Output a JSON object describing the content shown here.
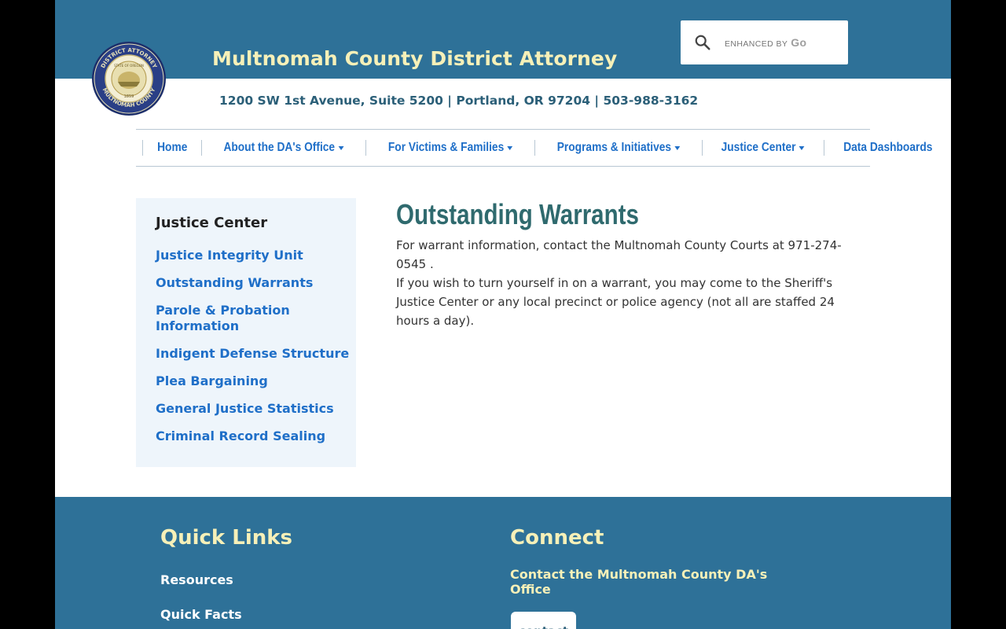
{
  "header": {
    "title": "Multnomah County District Attorney",
    "address": "1200 SW 1st Avenue, Suite 5200 | Portland, OR 97204 | 503-988-3162",
    "seal": {
      "top_text": "DISTRICT ATTORNEY",
      "bottom_text": "MULTNOMAH COUNTY",
      "inner_top": "STATE OF OREGON",
      "year": "1859"
    }
  },
  "search": {
    "brand_prefix": "ENHANCED BY",
    "brand_name": "Go",
    "icon": "search-icon"
  },
  "nav": {
    "items": [
      {
        "label": "Home",
        "dropdown": false
      },
      {
        "label": "About the DA's Office",
        "dropdown": true
      },
      {
        "label": "For Victims & Families",
        "dropdown": true
      },
      {
        "label": "Programs & Initiatives",
        "dropdown": true
      },
      {
        "label": "Justice Center",
        "dropdown": true
      },
      {
        "label": "Data Dashboards",
        "dropdown": false
      }
    ]
  },
  "sidebar": {
    "title": "Justice Center",
    "links": [
      "Justice Integrity Unit",
      "Outstanding Warrants",
      "Parole & Probation Information",
      "Indigent Defense Structure",
      "Plea Bargaining",
      "General Justice Statistics",
      "Criminal Record Sealing"
    ]
  },
  "main": {
    "title": "Outstanding Warrants",
    "line1": "For warrant information, contact the Multnomah County Courts at 971-274-0545 .",
    "line2": "If you wish to turn yourself in on a warrant, you may come to the Sheriff's Justice Center or any local precinct or police agency (not all are staffed 24 hours a day)."
  },
  "footer": {
    "quick_links_title": "Quick Links",
    "quick_links": [
      "Resources",
      "Quick Facts"
    ],
    "connect_title": "Connect",
    "contact_heading": "Contact the Multnomah County DA's Office",
    "contact_button": "contact"
  },
  "colors": {
    "header_band": "#2e7198",
    "title_yellow": "#f6f0b8",
    "link_blue": "#1f6fc8",
    "sidebar_bg": "#eef5fb",
    "heading_teal": "#2f6a6e"
  }
}
